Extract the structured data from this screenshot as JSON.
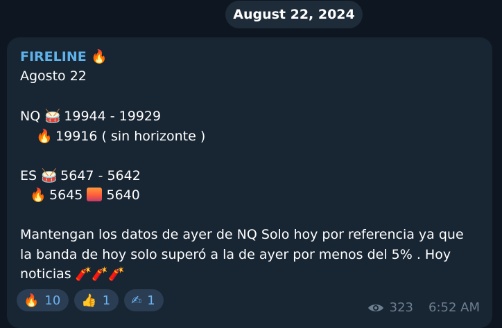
{
  "date_pill": "August 22, 2024",
  "message": {
    "sender": "FIRELINE",
    "lines": [
      "Agosto 22",
      "NQ",
      "19944 - 19929",
      "19916  ( sin horizonte )",
      "ES",
      "5647 - 5642",
      "5645",
      "5640",
      "Mantengan los datos de ayer de NQ Solo hoy por referencia ya que",
      "la banda de hoy solo superó a la de ayer por menos del 5% . Hoy",
      "noticias"
    ]
  },
  "reactions": [
    {
      "emoji": "🔥",
      "count": "10"
    },
    {
      "emoji": "👍",
      "count": "1"
    },
    {
      "emoji": "✍",
      "count": "1"
    }
  ],
  "meta": {
    "views": "323",
    "time": "6:52 AM"
  },
  "icons": {
    "fire": "fire-icon",
    "drum": "drum-icon",
    "sunset": "sunset-icon",
    "dynamite": "firecracker-icon",
    "eye": "eye-icon"
  }
}
